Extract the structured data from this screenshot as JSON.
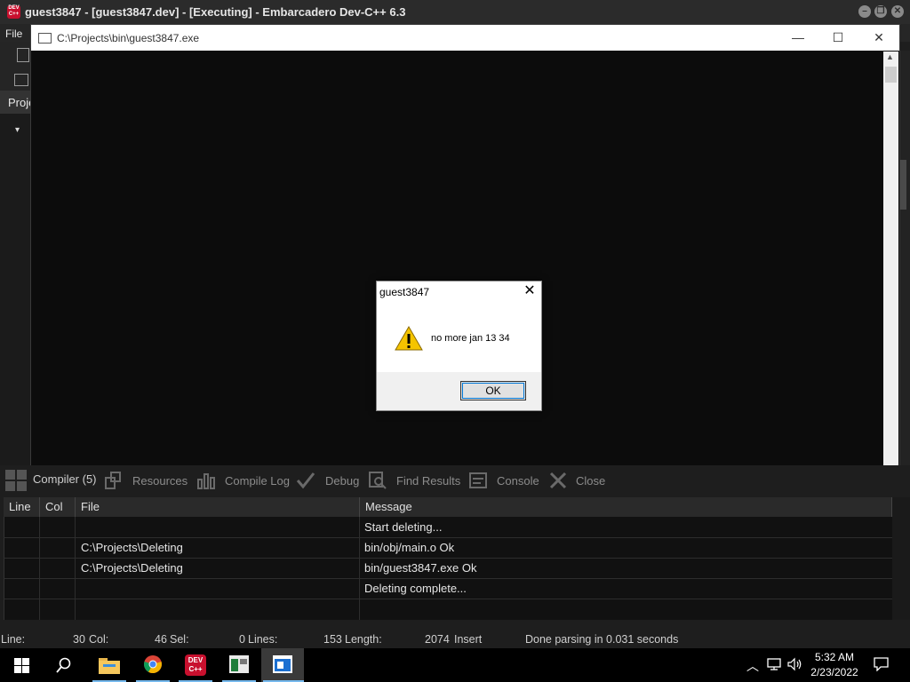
{
  "ide": {
    "title": "guest3847 - [guest3847.dev] - [Executing] - Embarcadero Dev-C++ 6.3",
    "logo_text": "DEV C++",
    "menu_file": "File",
    "project_tab": "Proje"
  },
  "console": {
    "title": "C:\\Projects\\bin\\guest3847.exe",
    "minimize": "—",
    "maximize": "☐",
    "close": "✕"
  },
  "msgbox": {
    "title": "guest3847",
    "close": "✕",
    "text": "no more jan 13 34",
    "ok": "OK"
  },
  "bottom_tabs": [
    "Compiler (5)",
    "Resources",
    "Compile Log",
    "Debug",
    "Find Results",
    "Console",
    "Close"
  ],
  "table": {
    "headers": [
      "Line",
      "Col",
      "File",
      "Message"
    ],
    "rows": [
      {
        "line": "",
        "col": "",
        "file": "",
        "message": "Start deleting..."
      },
      {
        "line": "",
        "col": "",
        "file": "C:\\Projects\\Deleting",
        "message": "bin/obj/main.o Ok"
      },
      {
        "line": "",
        "col": "",
        "file": "C:\\Projects\\Deleting",
        "message": "bin/guest3847.exe Ok"
      },
      {
        "line": "",
        "col": "",
        "file": "",
        "message": "Deleting complete..."
      }
    ]
  },
  "status": {
    "line_label": "Line:",
    "line_value": "30",
    "col_label": "Col:",
    "col_value": "46",
    "sel_label": "Sel:",
    "sel_value": "0",
    "lines_label": "Lines:",
    "lines_value": "153",
    "length_label": "Length:",
    "length_value": "2074",
    "mode": "Insert",
    "message": "Done parsing in 0.031 seconds"
  },
  "taskbar": {
    "time": "5:32 AM",
    "date": "2/23/2022",
    "devcpp_badge": "DEV C++"
  },
  "colors": {
    "accent": "#0078d7",
    "taskbar_underline": "#76b9ed",
    "warning_yellow": "#f5c400"
  }
}
